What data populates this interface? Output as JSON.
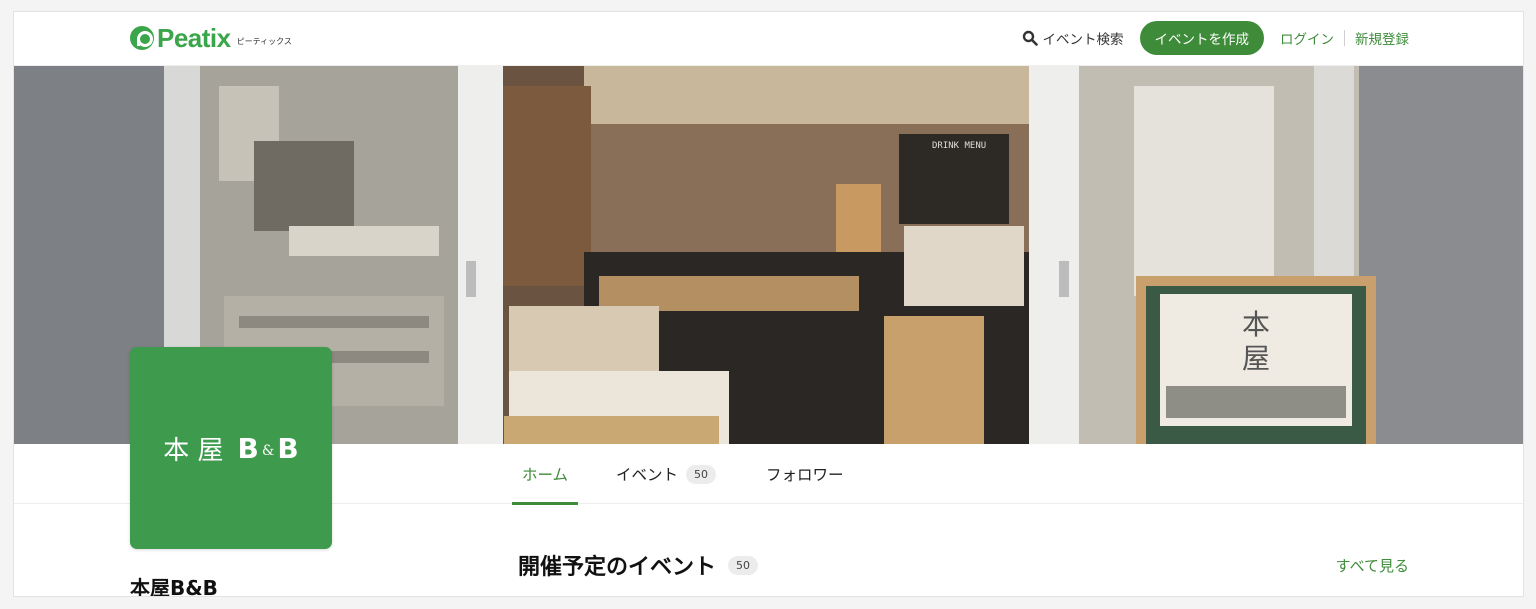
{
  "header": {
    "logo_text": "Peatix",
    "logo_kana": "ピーティックス",
    "search_label": "イベント検索",
    "create_button": "イベントを作成",
    "login": "ログイン",
    "signup": "新規登録"
  },
  "org": {
    "logo_text_left": "本 屋",
    "logo_text_b1": "B",
    "logo_text_amp": "&",
    "logo_text_b2": "B",
    "name": "本屋B&B"
  },
  "banner": {
    "sign_char_1": "本",
    "sign_char_2": "屋",
    "menu_title": "DRINK MENU"
  },
  "tabs": [
    {
      "label": "ホーム"
    },
    {
      "label": "イベント",
      "count": "50"
    },
    {
      "label": "フォロワー"
    }
  ],
  "section": {
    "title": "開催予定のイベント",
    "count": "50",
    "see_all": "すべて見る"
  },
  "colors": {
    "brand_green": "#3aa54a",
    "accent_green": "#3e8c3a"
  }
}
